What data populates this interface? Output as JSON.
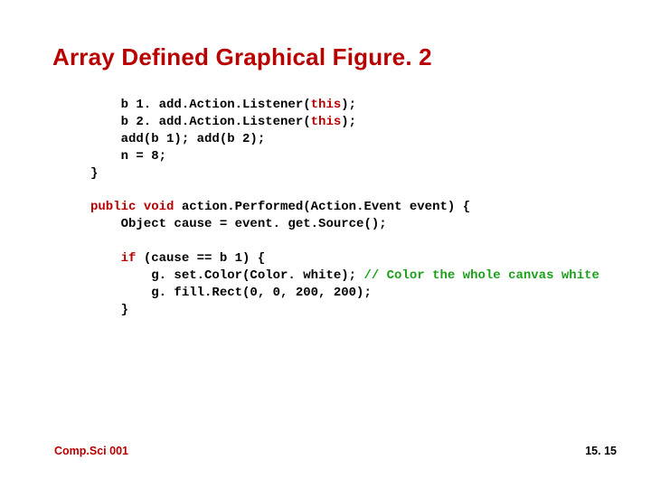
{
  "title": "Array Defined Graphical Figure. 2",
  "code": {
    "l1a": "    b 1. add.Action.Listener(",
    "l1kw": "this",
    "l1b": ");",
    "l2a": "    b 2. add.Action.Listener(",
    "l2kw": "this",
    "l2b": ");",
    "l3": "    add(b 1); add(b 2);",
    "l4": "    n = 8;",
    "l5": "}",
    "l6": "",
    "l7kw1": "public",
    "l7sp1": " ",
    "l7kw2": "void",
    "l7rest": " action.Performed(Action.Event event) {",
    "l8": "    Object cause = event. get.Source();",
    "l9": "",
    "l10a": "    ",
    "l10kw": "if",
    "l10b": " (cause == b 1) {",
    "l11a": "        g. set.Color(Color. white); ",
    "l11cm": "// Color the whole canvas white",
    "l12": "        g. fill.Rect(0, 0, 200, 200);",
    "l13": "    }"
  },
  "footer": {
    "left": "Comp.Sci 001",
    "right": "15. 15"
  }
}
